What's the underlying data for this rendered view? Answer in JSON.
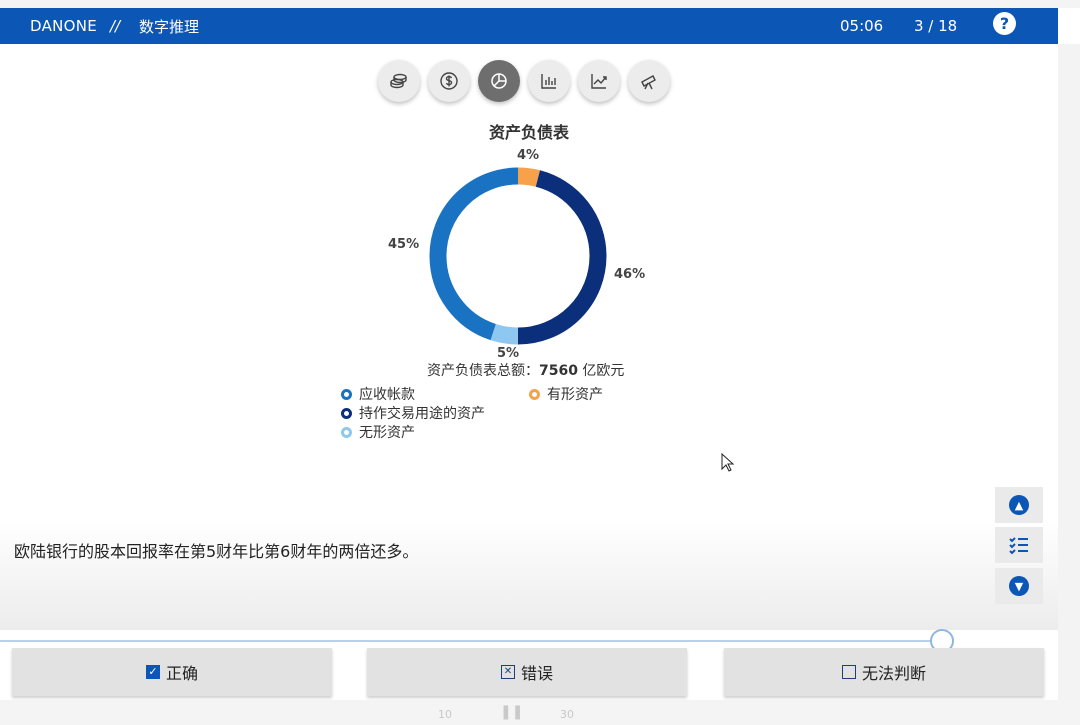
{
  "header": {
    "brand": "DANONE",
    "separator": "//",
    "section": "数字推理",
    "timer": "05:06",
    "progress": "3 / 18",
    "help_icon": "?"
  },
  "tabs": [
    {
      "icon": "coins-icon",
      "active": false
    },
    {
      "icon": "dollar-icon",
      "active": false
    },
    {
      "icon": "pie-chart-icon",
      "active": true
    },
    {
      "icon": "bar-chart-icon",
      "active": false
    },
    {
      "icon": "line-chart-icon",
      "active": false
    },
    {
      "icon": "telescope-icon",
      "active": false
    }
  ],
  "chart_data": {
    "type": "pie",
    "title": "资产负债表",
    "slices": [
      {
        "label": "有形资产",
        "value": 4,
        "display": "4%",
        "color": "#f7a24a"
      },
      {
        "label": "持作交易用途的资产",
        "value": 46,
        "display": "46%",
        "color": "#0b2f7a"
      },
      {
        "label": "无形资产",
        "value": 5,
        "display": "5%",
        "color": "#8ec8f0"
      },
      {
        "label": "应收帐款",
        "value": 45,
        "display": "45%",
        "color": "#1a72c2"
      }
    ],
    "total_label": "资产负债表总额：",
    "total_value": "7560",
    "total_unit": "亿欧元",
    "legend": [
      "应收帐款",
      "有形资产",
      "持作交易用途的资产",
      "无形资产"
    ]
  },
  "question": "欧陆银行的股本回报率在第5财年比第6财年的两倍还多。",
  "answers": {
    "true_label": "正确",
    "false_label": "错误",
    "unknown_label": "无法判断"
  },
  "bottom": {
    "rewind": "10",
    "forward": "30"
  },
  "colors": {
    "accent": "#0c56b6"
  }
}
